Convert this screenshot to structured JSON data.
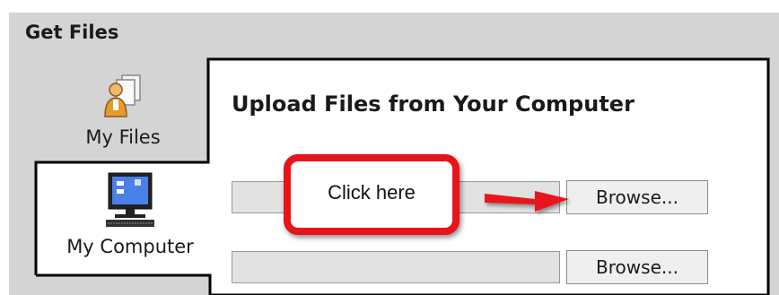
{
  "window": {
    "title": "Get Files"
  },
  "tabs": [
    {
      "label": "My Files",
      "icon": "person-document-icon",
      "selected": false
    },
    {
      "label": "My Computer",
      "icon": "computer-icon",
      "selected": true
    }
  ],
  "upload": {
    "heading": "Upload Files from Your Computer",
    "rows": [
      {
        "value": "",
        "browse_label": "Browse..."
      },
      {
        "value": "",
        "browse_label": "Browse..."
      }
    ]
  },
  "annotation": {
    "callout_text": "Click here",
    "color": "#e8141a"
  }
}
